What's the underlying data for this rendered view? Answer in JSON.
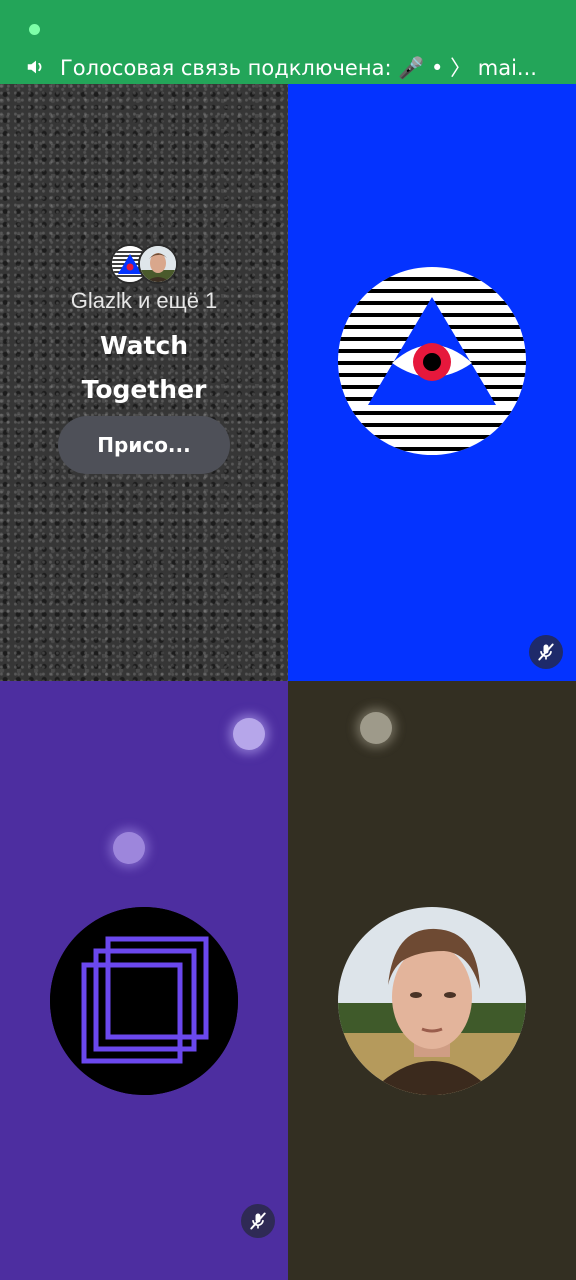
{
  "voice_bar": {
    "text": "Голосовая связь подключена: 🎤 • 〉 mai..."
  },
  "activity": {
    "participants": "Glazlk и ещё 1",
    "title_line1": "Watch",
    "title_line2": "Together",
    "join_label": "Присо..."
  },
  "tiles": [
    {
      "name": "watch-together-activity",
      "background": "#1b1b1b"
    },
    {
      "name": "eye-triangle-user",
      "background": "#0433ff",
      "muted": true
    },
    {
      "name": "purple-squares-user",
      "background": "#4d2ea0",
      "muted": true
    },
    {
      "name": "photo-user",
      "background": "#332f22",
      "muted": false
    }
  ],
  "colors": {
    "voice_bar": "#23a559",
    "join_button": "#4e5058"
  },
  "icons": [
    "speaker-icon",
    "muted-mic-icon"
  ]
}
